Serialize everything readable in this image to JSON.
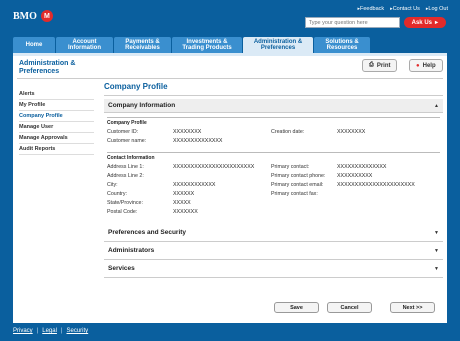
{
  "brand": {
    "name": "BMO",
    "mark": "M"
  },
  "top_links": [
    "Feedback",
    "Contact Us",
    "Log Out"
  ],
  "search": {
    "placeholder": "Type your question here",
    "ask_label": "Ask Us"
  },
  "nav": {
    "tabs": [
      {
        "line1": "Home",
        "line2": ""
      },
      {
        "line1": "Account",
        "line2": "Information"
      },
      {
        "line1": "Payments &",
        "line2": "Receivables"
      },
      {
        "line1": "Investments &",
        "line2": "Trading Products"
      },
      {
        "line1": "Administration &",
        "line2": "Preferences"
      },
      {
        "line1": "Solutions &",
        "line2": "Resources"
      }
    ]
  },
  "sidebar": {
    "title": "Administration & Preferences",
    "items": [
      "Alerts",
      "My Profile",
      "Company Profile",
      "Manage User",
      "Manage Approvals",
      "Audit Reports"
    ]
  },
  "toolbar": {
    "print_label": "Print",
    "help_label": "Help"
  },
  "page": {
    "title": "Company Profile",
    "company_info": {
      "heading": "Company Information",
      "profile_box": {
        "title": "Company Profile",
        "customer_id_label": "Customer ID:",
        "customer_id": "XXXXXXXX",
        "creation_date_label": "Creation date:",
        "creation_date": "XXXXXXXX",
        "customer_name_label": "Customer name:",
        "customer_name": "XXXXXXXXXXXXXX"
      },
      "contact_box": {
        "title": "Contact Information",
        "rows": [
          {
            "l1": "Address Line 1:",
            "v1": "XXXXXXXXXXXXXXXXXXXXXXX",
            "l2": "Primary contact:",
            "v2": "XXXXXXXXXXXXXX"
          },
          {
            "l1": "Address Line 2:",
            "v1": "",
            "l2": "Primary contact phone:",
            "v2": "XXXXXXXXXX"
          },
          {
            "l1": "City:",
            "v1": "XXXXXXXXXXXX",
            "l2": "Primary contact email:",
            "v2": "XXXXXXXXXXXXXXXXXXXXXX"
          },
          {
            "l1": "Country:",
            "v1": "XXXXXX",
            "l2": "Primary contact fax:",
            "v2": ""
          },
          {
            "l1": "State/Province:",
            "v1": "XXXXX",
            "l2": "",
            "v2": ""
          },
          {
            "l1": "Postal Code:",
            "v1": "XXXXXXX",
            "l2": "",
            "v2": ""
          }
        ]
      }
    },
    "sections": [
      "Preferences and Security",
      "Administrators",
      "Services"
    ],
    "buttons": {
      "save": "Save",
      "cancel": "Cancel",
      "next": "Next >>"
    }
  },
  "footer": {
    "links": [
      "Privacy",
      "Legal",
      "Security"
    ],
    "separator": "|"
  }
}
